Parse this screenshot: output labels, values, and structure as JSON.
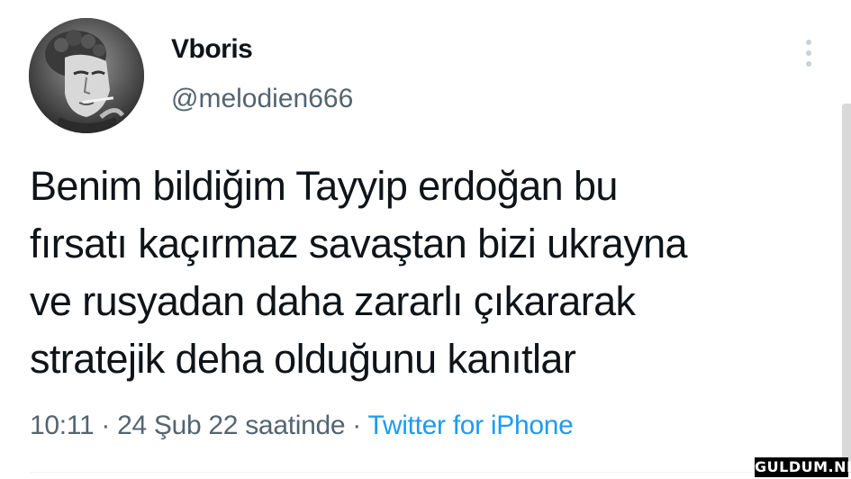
{
  "tweet": {
    "author": {
      "display_name": "Vboris",
      "handle": "@melodien666"
    },
    "text_lines": [
      "Benim bildiğim Tayyip erdoğan bu",
      "fırsatı kaçırmaz savaştan bizi ukrayna",
      "ve rusyadan daha zararlı çıkararak",
      "stratejik deha olduğunu kanıtlar"
    ],
    "timestamp": "10:11 · 24 Şub 22 saatinde",
    "separator": " · ",
    "source": "Twitter for iPhone"
  },
  "icons": {
    "more": "more-vertical-icon",
    "avatar": "statue-avatar"
  },
  "watermark": "GULDUM.NET",
  "colors": {
    "text": "#0f1419",
    "secondary_text": "#536471",
    "link": "#1d9bf0",
    "background": "#ffffff"
  }
}
